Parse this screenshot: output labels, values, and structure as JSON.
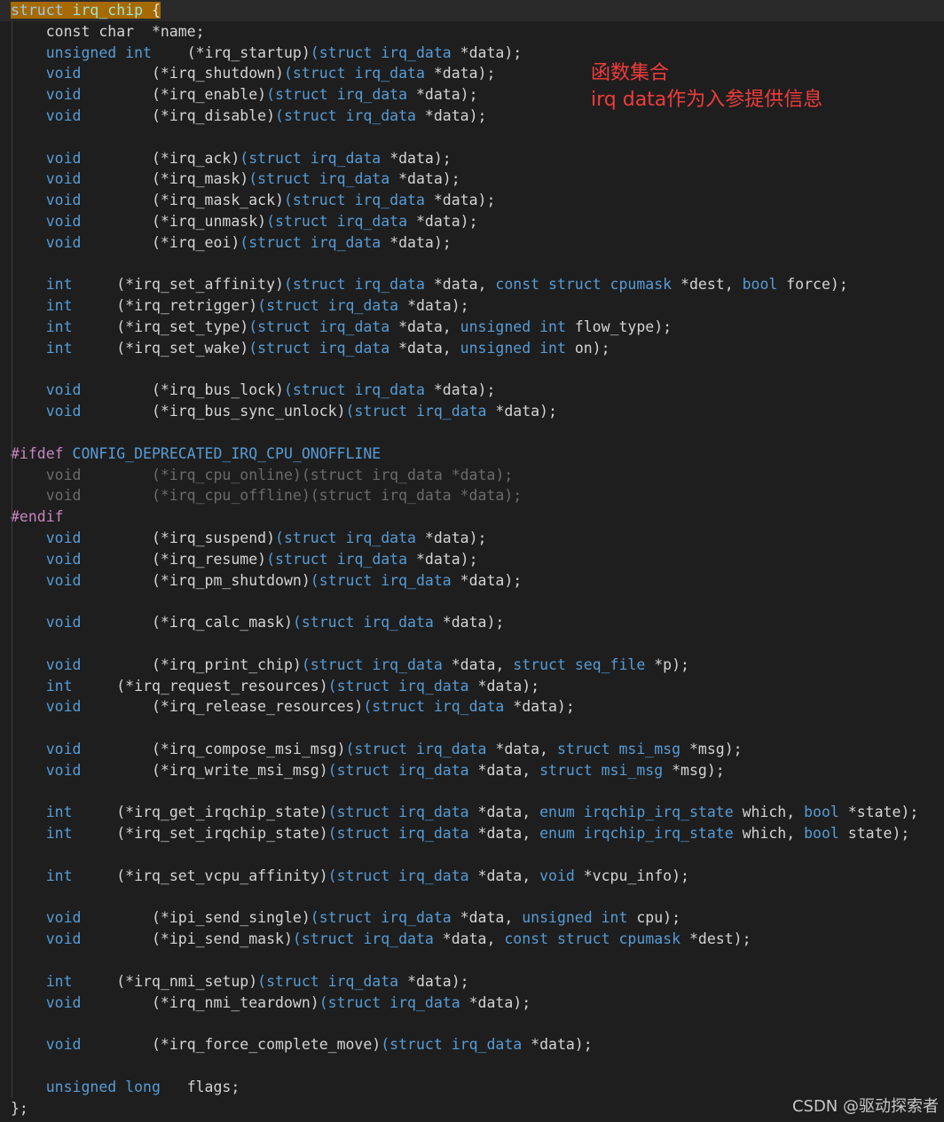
{
  "colors": {
    "background": "#1e1e1e",
    "keyword": "#569cd6",
    "type": "#4ec9b0",
    "identifier": "#d4d4d4",
    "preprocessor": "#c586c0",
    "annotation": "#f03c3c",
    "selection": "#a66a00"
  },
  "annotation": {
    "line1": "函数集合",
    "line2": "irq data作为入参提供信息"
  },
  "watermark": "CSDN @驱动探索者",
  "code_lines": [
    [
      [
        "struct",
        "sel-kw"
      ],
      [
        " ",
        "sel"
      ],
      [
        "irq_chip",
        "sel-type"
      ],
      [
        " ",
        "sel"
      ],
      [
        "{",
        "sel"
      ]
    ],
    [
      [
        "    const char  *name;",
        "ident"
      ]
    ],
    [
      [
        "    unsigned int",
        "kw"
      ],
      [
        "    (*irq_startup)",
        "ident"
      ],
      [
        "(struct irq_data ",
        "kw"
      ],
      [
        "*data);",
        "ident"
      ]
    ],
    [
      [
        "    void",
        "kw"
      ],
      [
        "        (*irq_shutdown)",
        "ident"
      ],
      [
        "(struct irq_data ",
        "kw"
      ],
      [
        "*data);",
        "ident"
      ]
    ],
    [
      [
        "    void",
        "kw"
      ],
      [
        "        (*irq_enable)",
        "ident"
      ],
      [
        "(struct irq_data ",
        "kw"
      ],
      [
        "*data);",
        "ident"
      ]
    ],
    [
      [
        "    void",
        "kw"
      ],
      [
        "        (*irq_disable)",
        "ident"
      ],
      [
        "(struct irq_data ",
        "kw"
      ],
      [
        "*data);",
        "ident"
      ]
    ],
    [],
    [
      [
        "    void",
        "kw"
      ],
      [
        "        (*irq_ack)",
        "ident"
      ],
      [
        "(struct irq_data ",
        "kw"
      ],
      [
        "*data);",
        "ident"
      ]
    ],
    [
      [
        "    void",
        "kw"
      ],
      [
        "        (*irq_mask)",
        "ident"
      ],
      [
        "(struct irq_data ",
        "kw"
      ],
      [
        "*data);",
        "ident"
      ]
    ],
    [
      [
        "    void",
        "kw"
      ],
      [
        "        (*irq_mask_ack)",
        "ident"
      ],
      [
        "(struct irq_data ",
        "kw"
      ],
      [
        "*data);",
        "ident"
      ]
    ],
    [
      [
        "    void",
        "kw"
      ],
      [
        "        (*irq_unmask)",
        "ident"
      ],
      [
        "(struct irq_data ",
        "kw"
      ],
      [
        "*data);",
        "ident"
      ]
    ],
    [
      [
        "    void",
        "kw"
      ],
      [
        "        (*irq_eoi)",
        "ident"
      ],
      [
        "(struct irq_data ",
        "kw"
      ],
      [
        "*data);",
        "ident"
      ]
    ],
    [],
    [
      [
        "    int",
        "kw"
      ],
      [
        "     (*irq_set_affinity)",
        "ident"
      ],
      [
        "(struct irq_data ",
        "kw"
      ],
      [
        "*data, ",
        "ident"
      ],
      [
        "const struct cpumask ",
        "kw"
      ],
      [
        "*dest, ",
        "ident"
      ],
      [
        "bool ",
        "kw"
      ],
      [
        "force);",
        "ident"
      ]
    ],
    [
      [
        "    int",
        "kw"
      ],
      [
        "     (*irq_retrigger)",
        "ident"
      ],
      [
        "(struct irq_data ",
        "kw"
      ],
      [
        "*data);",
        "ident"
      ]
    ],
    [
      [
        "    int",
        "kw"
      ],
      [
        "     (*irq_set_type)",
        "ident"
      ],
      [
        "(struct irq_data ",
        "kw"
      ],
      [
        "*data, ",
        "ident"
      ],
      [
        "unsigned int ",
        "kw"
      ],
      [
        "flow_type);",
        "ident"
      ]
    ],
    [
      [
        "    int",
        "kw"
      ],
      [
        "     (*irq_set_wake)",
        "ident"
      ],
      [
        "(struct irq_data ",
        "kw"
      ],
      [
        "*data, ",
        "ident"
      ],
      [
        "unsigned int ",
        "kw"
      ],
      [
        "on);",
        "ident"
      ]
    ],
    [],
    [
      [
        "    void",
        "kw"
      ],
      [
        "        (*irq_bus_lock)",
        "ident"
      ],
      [
        "(struct irq_data ",
        "kw"
      ],
      [
        "*data);",
        "ident"
      ]
    ],
    [
      [
        "    void",
        "kw"
      ],
      [
        "        (*irq_bus_sync_unlock)",
        "ident"
      ],
      [
        "(struct irq_data ",
        "kw"
      ],
      [
        "*data);",
        "ident"
      ]
    ],
    [],
    [
      [
        "#ifdef ",
        "pp"
      ],
      [
        "CONFIG_DEPRECATED_IRQ_CPU_ONOFFLINE",
        "ppname"
      ]
    ],
    [
      [
        "    void        (*irq_cpu_online)(struct irq_data *data);",
        "dim"
      ]
    ],
    [
      [
        "    void        (*irq_cpu_offline)(struct irq_data *data);",
        "dim"
      ]
    ],
    [
      [
        "#endif",
        "pp"
      ]
    ],
    [
      [
        "    void",
        "kw"
      ],
      [
        "        (*irq_suspend)",
        "ident"
      ],
      [
        "(struct irq_data ",
        "kw"
      ],
      [
        "*data);",
        "ident"
      ]
    ],
    [
      [
        "    void",
        "kw"
      ],
      [
        "        (*irq_resume)",
        "ident"
      ],
      [
        "(struct irq_data ",
        "kw"
      ],
      [
        "*data);",
        "ident"
      ]
    ],
    [
      [
        "    void",
        "kw"
      ],
      [
        "        (*irq_pm_shutdown)",
        "ident"
      ],
      [
        "(struct irq_data ",
        "kw"
      ],
      [
        "*data);",
        "ident"
      ]
    ],
    [],
    [
      [
        "    void",
        "kw"
      ],
      [
        "        (*irq_calc_mask)",
        "ident"
      ],
      [
        "(struct irq_data ",
        "kw"
      ],
      [
        "*data);",
        "ident"
      ]
    ],
    [],
    [
      [
        "    void",
        "kw"
      ],
      [
        "        (*irq_print_chip)",
        "ident"
      ],
      [
        "(struct irq_data ",
        "kw"
      ],
      [
        "*data, ",
        "ident"
      ],
      [
        "struct seq_file ",
        "kw"
      ],
      [
        "*p);",
        "ident"
      ]
    ],
    [
      [
        "    int",
        "kw"
      ],
      [
        "     (*irq_request_resources)",
        "ident"
      ],
      [
        "(struct irq_data ",
        "kw"
      ],
      [
        "*data);",
        "ident"
      ]
    ],
    [
      [
        "    void",
        "kw"
      ],
      [
        "        (*irq_release_resources)",
        "ident"
      ],
      [
        "(struct irq_data ",
        "kw"
      ],
      [
        "*data);",
        "ident"
      ]
    ],
    [],
    [
      [
        "    void",
        "kw"
      ],
      [
        "        (*irq_compose_msi_msg)",
        "ident"
      ],
      [
        "(struct irq_data ",
        "kw"
      ],
      [
        "*data, ",
        "ident"
      ],
      [
        "struct msi_msg ",
        "kw"
      ],
      [
        "*msg);",
        "ident"
      ]
    ],
    [
      [
        "    void",
        "kw"
      ],
      [
        "        (*irq_write_msi_msg)",
        "ident"
      ],
      [
        "(struct irq_data ",
        "kw"
      ],
      [
        "*data, ",
        "ident"
      ],
      [
        "struct msi_msg ",
        "kw"
      ],
      [
        "*msg);",
        "ident"
      ]
    ],
    [],
    [
      [
        "    int",
        "kw"
      ],
      [
        "     (*irq_get_irqchip_state)",
        "ident"
      ],
      [
        "(struct irq_data ",
        "kw"
      ],
      [
        "*data, ",
        "ident"
      ],
      [
        "enum irqchip_irq_state ",
        "kw"
      ],
      [
        "which, ",
        "ident"
      ],
      [
        "bool ",
        "kw"
      ],
      [
        "*state);",
        "ident"
      ]
    ],
    [
      [
        "    int",
        "kw"
      ],
      [
        "     (*irq_set_irqchip_state)",
        "ident"
      ],
      [
        "(struct irq_data ",
        "kw"
      ],
      [
        "*data, ",
        "ident"
      ],
      [
        "enum irqchip_irq_state ",
        "kw"
      ],
      [
        "which, ",
        "ident"
      ],
      [
        "bool ",
        "kw"
      ],
      [
        "state);",
        "ident"
      ]
    ],
    [],
    [
      [
        "    int",
        "kw"
      ],
      [
        "     (*irq_set_vcpu_affinity)",
        "ident"
      ],
      [
        "(struct irq_data ",
        "kw"
      ],
      [
        "*data, ",
        "ident"
      ],
      [
        "void ",
        "kw"
      ],
      [
        "*vcpu_info);",
        "ident"
      ]
    ],
    [],
    [
      [
        "    void",
        "kw"
      ],
      [
        "        (*ipi_send_single)",
        "ident"
      ],
      [
        "(struct irq_data ",
        "kw"
      ],
      [
        "*data, ",
        "ident"
      ],
      [
        "unsigned int ",
        "kw"
      ],
      [
        "cpu);",
        "ident"
      ]
    ],
    [
      [
        "    void",
        "kw"
      ],
      [
        "        (*ipi_send_mask)",
        "ident"
      ],
      [
        "(struct irq_data ",
        "kw"
      ],
      [
        "*data, ",
        "ident"
      ],
      [
        "const struct cpumask ",
        "kw"
      ],
      [
        "*dest);",
        "ident"
      ]
    ],
    [],
    [
      [
        "    int",
        "kw"
      ],
      [
        "     (*irq_nmi_setup)",
        "ident"
      ],
      [
        "(struct irq_data ",
        "kw"
      ],
      [
        "*data);",
        "ident"
      ]
    ],
    [
      [
        "    void",
        "kw"
      ],
      [
        "        (*irq_nmi_teardown)",
        "ident"
      ],
      [
        "(struct irq_data ",
        "kw"
      ],
      [
        "*data);",
        "ident"
      ]
    ],
    [],
    [
      [
        "    void",
        "kw"
      ],
      [
        "        (*irq_force_complete_move)",
        "ident"
      ],
      [
        "(struct irq_data ",
        "kw"
      ],
      [
        "*data);",
        "ident"
      ]
    ],
    [],
    [
      [
        "    unsigned long",
        "kw"
      ],
      [
        "   flags;",
        "ident"
      ]
    ],
    [
      [
        "};",
        "ident"
      ]
    ]
  ]
}
